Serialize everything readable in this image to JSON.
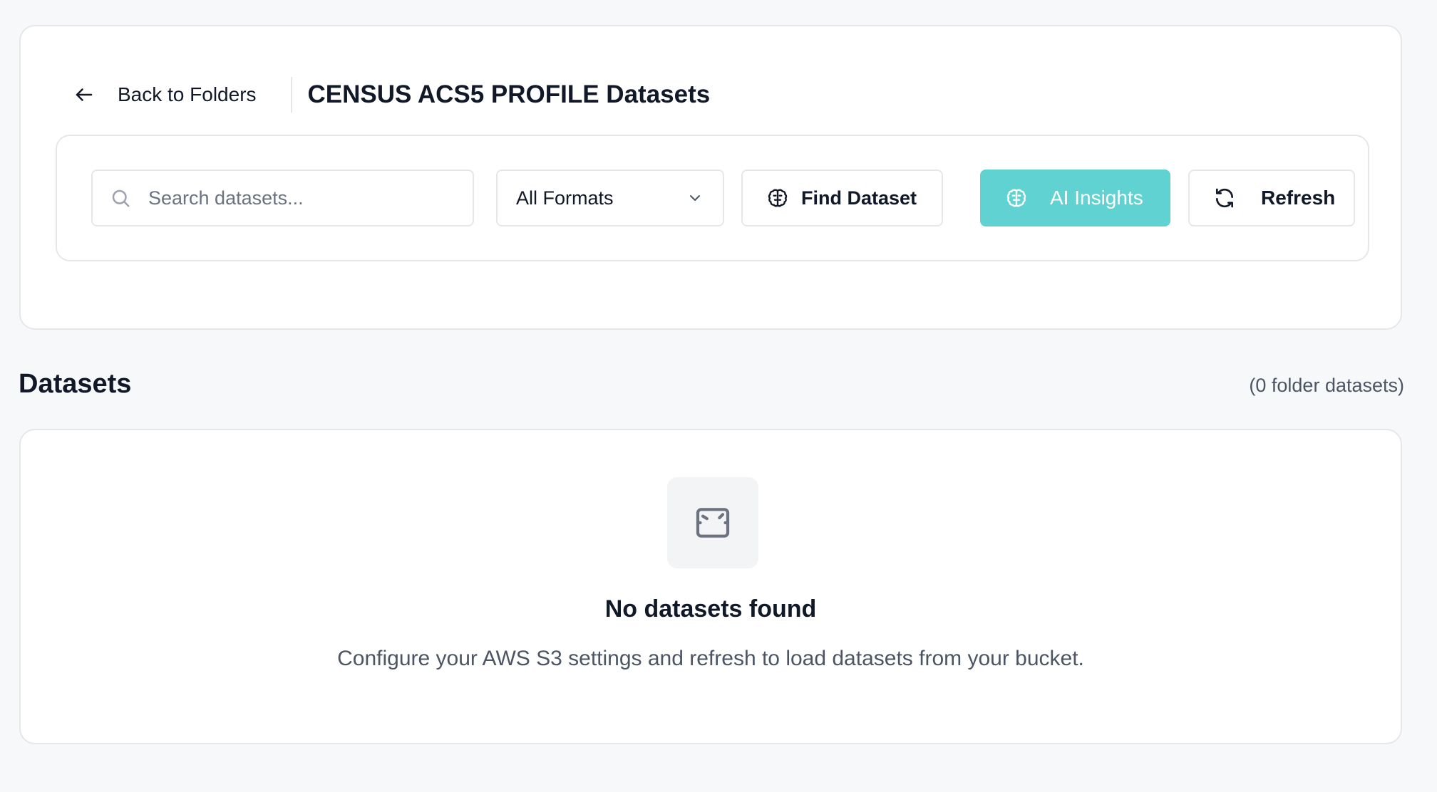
{
  "header": {
    "back_label": "Back to Folders",
    "title": "CENSUS ACS5 PROFILE Datasets"
  },
  "toolbar": {
    "search_placeholder": "Search datasets...",
    "search_value": "",
    "format_selected": "All Formats",
    "find_dataset_label": "Find Dataset",
    "ai_insights_label": "AI Insights",
    "refresh_label": "Refresh",
    "accent_color": "#60d2d1"
  },
  "datasets_section": {
    "title": "Datasets",
    "count_text": "(0 folder datasets)"
  },
  "empty_state": {
    "icon": "image-placeholder-icon",
    "title": "No datasets found",
    "description": "Configure your AWS S3 settings and refresh to load datasets from your bucket."
  },
  "icons": {
    "back": "arrow-left-icon",
    "search": "search-icon",
    "format_dropdown": "chevron-down-icon",
    "find_dataset": "brain-icon",
    "ai_insights": "brain-icon",
    "refresh": "refresh-icon"
  }
}
